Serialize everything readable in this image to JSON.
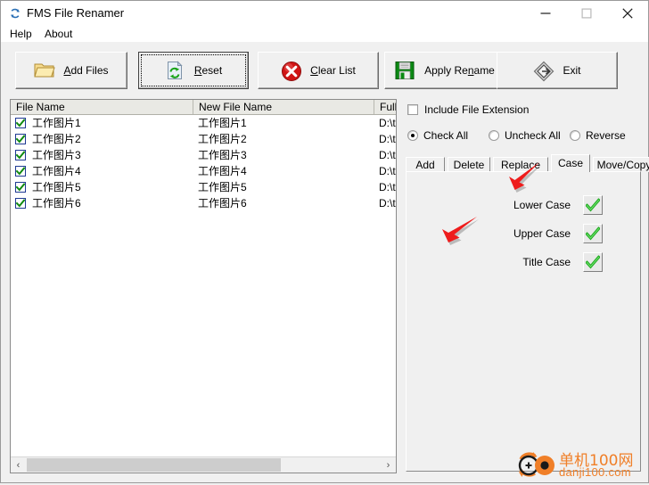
{
  "window": {
    "title": "FMS File Renamer",
    "icon": "refresh-circle-icon",
    "minimize_label": "—",
    "maximize_label": "□",
    "close_label": "✕"
  },
  "menu": {
    "items": [
      {
        "label": "Help"
      },
      {
        "label": "About"
      }
    ]
  },
  "toolbar": {
    "buttons": [
      {
        "label": "Add Files",
        "accel": "A",
        "icon": "folder-icon",
        "focused": false
      },
      {
        "label": "Reset",
        "accel": "R",
        "icon": "page-refresh-icon",
        "focused": true
      },
      {
        "label": "Clear List",
        "accel": "C",
        "icon": "red-x-circle-icon",
        "focused": false
      },
      {
        "label": "Apply Rename",
        "accel": "n",
        "icon": "floppy-save-icon",
        "focused": false
      },
      {
        "label": "Exit",
        "accel": "",
        "icon": "diamond-exit-icon",
        "focused": false
      }
    ]
  },
  "file_list": {
    "columns": [
      "File Name",
      "New File Name",
      "Full P"
    ],
    "rows": [
      {
        "checked": true,
        "name": "工作图片1",
        "new_name": "工作图片1",
        "full_path": "D:\\t"
      },
      {
        "checked": true,
        "name": "工作图片2",
        "new_name": "工作图片2",
        "full_path": "D:\\t"
      },
      {
        "checked": true,
        "name": "工作图片3",
        "new_name": "工作图片3",
        "full_path": "D:\\t"
      },
      {
        "checked": true,
        "name": "工作图片4",
        "new_name": "工作图片4",
        "full_path": "D:\\t"
      },
      {
        "checked": true,
        "name": "工作图片5",
        "new_name": "工作图片5",
        "full_path": "D:\\t"
      },
      {
        "checked": true,
        "name": "工作图片6",
        "new_name": "工作图片6",
        "full_path": "D:\\t"
      }
    ],
    "scroll_left_icon": "‹",
    "scroll_right_icon": "›"
  },
  "options": {
    "include_extension": {
      "label": "Include File Extension",
      "checked": false
    },
    "selection_mode": {
      "selected": "Check All",
      "radios": [
        {
          "label": "Check All",
          "selected": true
        },
        {
          "label": "Uncheck All",
          "selected": false
        },
        {
          "label": "Reverse",
          "selected": false
        }
      ]
    }
  },
  "tabs": {
    "active": "Case",
    "items": [
      {
        "label": "Add",
        "active": false
      },
      {
        "label": "Delete",
        "active": false
      },
      {
        "label": "Replace",
        "active": false
      },
      {
        "label": "Case",
        "active": true
      },
      {
        "label": "Move/Copy",
        "active": false
      }
    ]
  },
  "case_panel": {
    "rows": [
      {
        "label": "Lower Case",
        "button_icon": "green-check-icon"
      },
      {
        "label": "Upper Case",
        "button_icon": "green-check-icon"
      },
      {
        "label": "Title Case",
        "button_icon": "green-check-icon"
      }
    ]
  },
  "annotations": [
    {
      "name": "arrow-to-case-tab",
      "color": "#ee1c1c",
      "points_at": "Case"
    },
    {
      "name": "arrow-to-upper-case",
      "color": "#ee1c1c",
      "points_at": "Upper Case"
    }
  ],
  "watermark": {
    "text_cn": "单机100网",
    "text_en": "danji100.com",
    "color": "#f07f28"
  }
}
